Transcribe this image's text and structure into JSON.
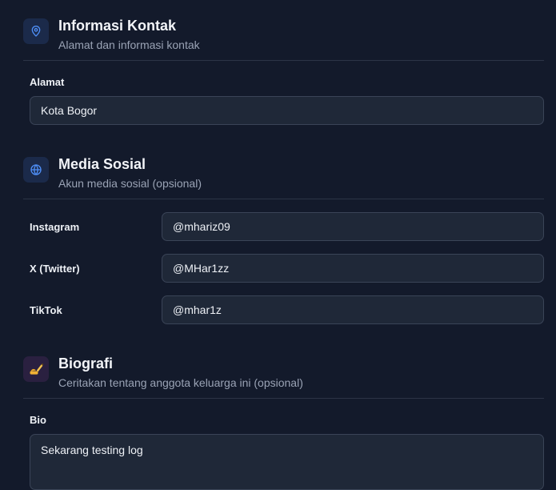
{
  "contact": {
    "title": "Informasi Kontak",
    "subtitle": "Alamat dan informasi kontak",
    "address_label": "Alamat",
    "address_value": "Kota Bogor"
  },
  "social": {
    "title": "Media Sosial",
    "subtitle": "Akun media sosial (opsional)",
    "fields": [
      {
        "label": "Instagram",
        "value": "@mhariz09"
      },
      {
        "label": "X (Twitter)",
        "value": "@MHar1zz"
      },
      {
        "label": "TikTok",
        "value": "@mhar1z"
      }
    ]
  },
  "bio": {
    "title": "Biografi",
    "subtitle": "Ceritakan tentang anggota keluarga ini (opsional)",
    "label": "Bio",
    "value": "Sekarang testing log",
    "icon": "writing-hand-icon"
  },
  "colors": {
    "background": "#131a2b",
    "input_bg": "#1f2838",
    "accent": "#4f8ff7"
  }
}
